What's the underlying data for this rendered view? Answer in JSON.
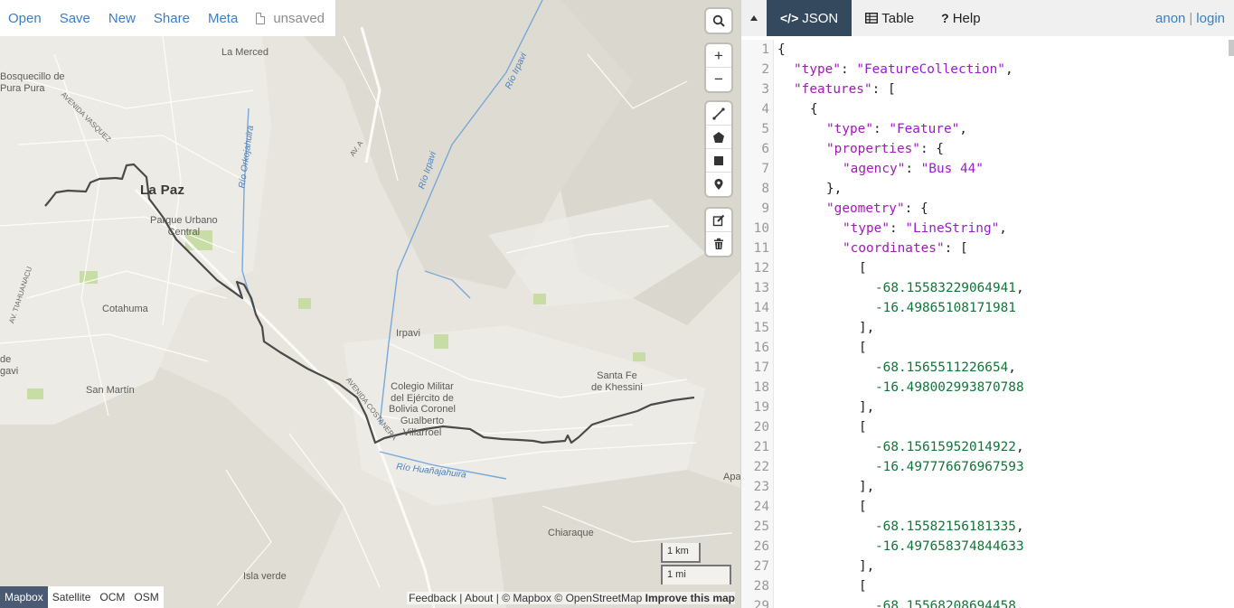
{
  "file_bar": {
    "open": "Open",
    "save": "Save",
    "new": "New",
    "share": "Share",
    "meta": "Meta",
    "status": "unsaved"
  },
  "map_controls": {
    "search_icon": "search-icon",
    "zoom_in": "+",
    "zoom_out": "−",
    "draw_tools": [
      "draw-line-icon",
      "draw-polygon-icon",
      "draw-rectangle-icon",
      "draw-marker-icon"
    ],
    "edit_tools": [
      "edit-icon",
      "delete-icon"
    ]
  },
  "map_labels": {
    "la_merced": "La Merced",
    "bosquecillo": "Bosquecillo de\nPura Pura",
    "avenida_vasquez": "AVENIDA VASQUEZ",
    "la_paz": "La Paz",
    "parque_urbano": "Parque Urbano\nCentral",
    "rio_orkojahuira": "Río Orkojahuira",
    "av_a": "AV. A",
    "rio_irpavi_1": "Río Irpavi",
    "rio_irpavi_2": "Río Irpavi",
    "tiahuanacu": "AV. TIAHUANACU",
    "cotahuma": "Cotahuma",
    "irpavi": "Irpavi",
    "de_gavi": "de\ngavi",
    "san_martin": "San Martín",
    "colegio": "Colegio Militar\ndel Ejército de\nBolivia Coronel\nGualberto\nVillarroel",
    "santa_fe": "Santa Fe\nde Khessini",
    "avenida_costanera": "AVENIDA COSTANERA",
    "rio_huanajahuira": "Río Huañajahuira",
    "apa": "Apa",
    "chiaraque": "Chiaraque",
    "isla_verde": "Isla verde"
  },
  "scale": {
    "km": "1 km",
    "mi": "1 mi"
  },
  "layers": [
    "Mapbox",
    "Satellite",
    "OCM",
    "OSM"
  ],
  "active_layer": "Mapbox",
  "attribution": {
    "feedback": "Feedback",
    "about": "About",
    "mapbox": "© Mapbox",
    "osm": "© OpenStreetMap",
    "improve": "Improve this map"
  },
  "pane": {
    "tabs": [
      "JSON",
      "Table",
      "Help"
    ],
    "active_tab": "JSON",
    "auth_anon": "anon",
    "auth_sep": "|",
    "auth_login": "login"
  },
  "editor_lines": [
    {
      "n": "1",
      "i": 0,
      "t": [
        [
          "p",
          "{"
        ]
      ]
    },
    {
      "n": "2",
      "i": 1,
      "t": [
        [
          "k",
          "\"type\""
        ],
        [
          "p",
          ": "
        ],
        [
          "s",
          "\"FeatureCollection\""
        ],
        [
          "p",
          ","
        ]
      ]
    },
    {
      "n": "3",
      "i": 1,
      "t": [
        [
          "k",
          "\"features\""
        ],
        [
          "p",
          ": ["
        ]
      ]
    },
    {
      "n": "4",
      "i": 2,
      "t": [
        [
          "p",
          "{"
        ]
      ]
    },
    {
      "n": "5",
      "i": 3,
      "t": [
        [
          "k",
          "\"type\""
        ],
        [
          "p",
          ": "
        ],
        [
          "s",
          "\"Feature\""
        ],
        [
          "p",
          ","
        ]
      ]
    },
    {
      "n": "6",
      "i": 3,
      "t": [
        [
          "k",
          "\"properties\""
        ],
        [
          "p",
          ": {"
        ]
      ]
    },
    {
      "n": "7",
      "i": 4,
      "t": [
        [
          "k",
          "\"agency\""
        ],
        [
          "p",
          ": "
        ],
        [
          "s",
          "\"Bus 44\""
        ]
      ]
    },
    {
      "n": "8",
      "i": 3,
      "t": [
        [
          "p",
          "},"
        ]
      ]
    },
    {
      "n": "9",
      "i": 3,
      "t": [
        [
          "k",
          "\"geometry\""
        ],
        [
          "p",
          ": {"
        ]
      ]
    },
    {
      "n": "10",
      "i": 4,
      "t": [
        [
          "k",
          "\"type\""
        ],
        [
          "p",
          ": "
        ],
        [
          "s",
          "\"LineString\""
        ],
        [
          "p",
          ","
        ]
      ]
    },
    {
      "n": "11",
      "i": 4,
      "t": [
        [
          "k",
          "\"coordinates\""
        ],
        [
          "p",
          ": ["
        ]
      ]
    },
    {
      "n": "12",
      "i": 5,
      "t": [
        [
          "p",
          "["
        ]
      ]
    },
    {
      "n": "13",
      "i": 6,
      "t": [
        [
          "n",
          "-68.15583229064941"
        ],
        [
          "p",
          ","
        ]
      ]
    },
    {
      "n": "14",
      "i": 6,
      "t": [
        [
          "n",
          "-16.49865108171981"
        ]
      ]
    },
    {
      "n": "15",
      "i": 5,
      "t": [
        [
          "p",
          "],"
        ]
      ]
    },
    {
      "n": "16",
      "i": 5,
      "t": [
        [
          "p",
          "["
        ]
      ]
    },
    {
      "n": "17",
      "i": 6,
      "t": [
        [
          "n",
          "-68.1565511226654"
        ],
        [
          "p",
          ","
        ]
      ]
    },
    {
      "n": "18",
      "i": 6,
      "t": [
        [
          "n",
          "-16.498002993870788"
        ]
      ]
    },
    {
      "n": "19",
      "i": 5,
      "t": [
        [
          "p",
          "],"
        ]
      ]
    },
    {
      "n": "20",
      "i": 5,
      "t": [
        [
          "p",
          "["
        ]
      ]
    },
    {
      "n": "21",
      "i": 6,
      "t": [
        [
          "n",
          "-68.15615952014922"
        ],
        [
          "p",
          ","
        ]
      ]
    },
    {
      "n": "22",
      "i": 6,
      "t": [
        [
          "n",
          "-16.497776676967593"
        ]
      ]
    },
    {
      "n": "23",
      "i": 5,
      "t": [
        [
          "p",
          "],"
        ]
      ]
    },
    {
      "n": "24",
      "i": 5,
      "t": [
        [
          "p",
          "["
        ]
      ]
    },
    {
      "n": "25",
      "i": 6,
      "t": [
        [
          "n",
          "-68.15582156181335"
        ],
        [
          "p",
          ","
        ]
      ]
    },
    {
      "n": "26",
      "i": 6,
      "t": [
        [
          "n",
          "-16.497658374844633"
        ]
      ]
    },
    {
      "n": "27",
      "i": 5,
      "t": [
        [
          "p",
          "],"
        ]
      ]
    },
    {
      "n": "28",
      "i": 5,
      "t": [
        [
          "p",
          "["
        ]
      ]
    },
    {
      "n": "29",
      "i": 6,
      "t": [
        [
          "n",
          "-68.15568208694458"
        ],
        [
          "p",
          ","
        ]
      ]
    }
  ],
  "colors": {
    "link": "#3a7fc6",
    "tab_active_bg": "#34495e",
    "json_key": "#a11bb5",
    "json_string": "#9a1bd0",
    "json_number": "#11753a",
    "route_line": "#4a4a4a",
    "river": "#7aa8d8",
    "park": "#c5dca0"
  }
}
